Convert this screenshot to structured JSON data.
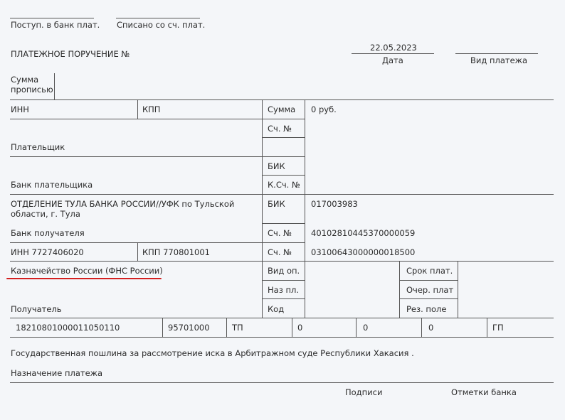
{
  "header": {
    "received_label": "Поступ. в банк плат.",
    "debited_label": "Списано со сч. плат.",
    "title": "ПЛАТЕЖНОЕ ПОРУЧЕНИЕ №",
    "date_value": "22.05.2023",
    "date_label": "Дата",
    "payment_type_label": "Вид платежа"
  },
  "amount_words_label": "Сумма прописью",
  "payer": {
    "inn_label": "ИНН",
    "kpp_label": "КПП",
    "sum_label": "Сумма",
    "sum_value": "0 руб.",
    "account_label": "Сч. №",
    "payer_label": "Плательщик",
    "bik_label": "БИК",
    "bank_label": "Банк плательщика",
    "corr_label": "К.Сч. №"
  },
  "recipient": {
    "bank_name": "ОТДЕЛЕНИЕ ТУЛА БАНКА РОССИИ//УФК по Тульской области, г. Тула",
    "bik_label": "БИК",
    "bik_value": "017003983",
    "bank_label": "Банк получателя",
    "corr_label": "Сч. №",
    "corr_value": "40102810445370000059",
    "inn_value": "ИНН 7727406020",
    "kpp_value": "КПП 770801001",
    "account_label": "Сч. №",
    "account_value": "03100643000000018500",
    "name": "Казначейство России (ФНС России)",
    "op_type_label": "Вид оп.",
    "due_label": "Срок плат.",
    "purpose_code_label": "Наз пл.",
    "order_label": "Очер. плат",
    "code_label": "Код",
    "reserve_label": "Рез. поле",
    "recipient_label": "Получатель"
  },
  "budget_row": {
    "kbk": "18210801000011050110",
    "oktmo": "95701000",
    "basis": "ТП",
    "period": "0",
    "doc_number": "0",
    "doc_date": "0",
    "type": "ГП"
  },
  "purpose_text": "Государственная пошлина за рассмотрение иска в Арбитражном суде Республики Хакасия .",
  "purpose_label": "Назначение платежа",
  "signatures_label": "Подписи",
  "bank_marks_label": "Отметки банка",
  "colors": {
    "underline": "#d42020",
    "line": "#555555",
    "background": "#f4f6f9"
  }
}
